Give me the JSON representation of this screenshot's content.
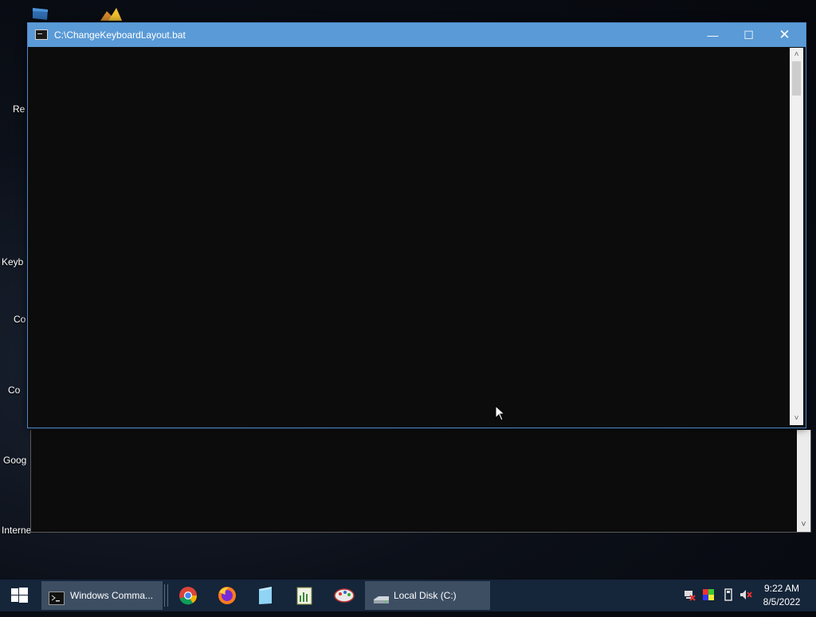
{
  "desktop": {
    "icon_labels": [
      "Re",
      "Keyb",
      "Co",
      "Co",
      "Goog",
      "Interne"
    ]
  },
  "console_window": {
    "title": "C:\\ChangeKeyboardLayout.bat",
    "minimize_glyph": "—",
    "maximize_glyph": "☐",
    "close_glyph": "✕",
    "scroll_up": "˄",
    "scroll_down": "˅"
  },
  "back_window": {
    "scroll_down": "˅"
  },
  "taskbar": {
    "tasks": [
      {
        "label": "Windows Comma...",
        "icon": "cmd-icon"
      },
      {
        "label": "Local Disk (C:)",
        "icon": "drive-icon"
      }
    ],
    "pinned": [
      "chrome-icon",
      "firefox-icon",
      "notepad-icon",
      "spreadsheet-icon",
      "paint-icon"
    ],
    "tray_icons": [
      "network-icon",
      "color-icon",
      "usb-icon",
      "volume-muted-icon"
    ],
    "clock": {
      "time": "9:22 AM",
      "date": "8/5/2022"
    }
  },
  "colors": {
    "titlebar": "#5a9ad6",
    "console_bg": "#0c0c0c",
    "taskbar": "#15253a",
    "active_task": "#3d4e63"
  }
}
